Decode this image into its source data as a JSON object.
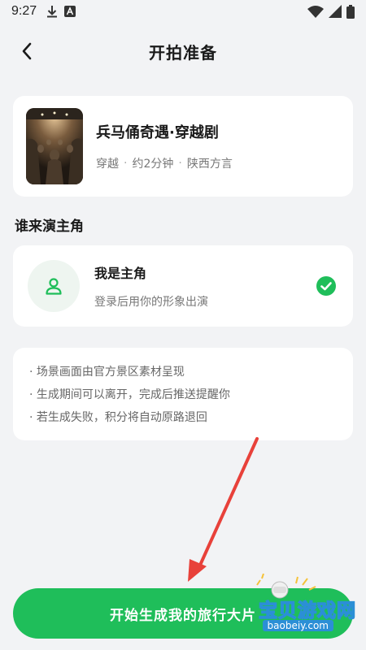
{
  "status_bar": {
    "time": "9:27",
    "icons": [
      "download-icon",
      "notification-a-icon",
      "wifi-icon",
      "signal-icon",
      "battery-icon"
    ]
  },
  "header": {
    "title": "开拍准备",
    "back_icon": "chevron-left-icon"
  },
  "project": {
    "title": "兵马俑奇遇·穿越剧",
    "meta": [
      "穿越",
      "约2分钟",
      "陕西方言"
    ],
    "meta_separator": "·"
  },
  "cast_section": {
    "title": "谁来演主角",
    "option": {
      "title": "我是主角",
      "description": "登录后用你的形象出演",
      "selected": true
    }
  },
  "tips": [
    "· 场景画面由官方景区素材呈现",
    "· 生成期间可以离开，完成后推送提醒你",
    "· 若生成失败，积分将自动原路退回"
  ],
  "start_button": {
    "label": "开始生成我的旅行大片"
  },
  "watermark": {
    "title": "宝贝游戏网",
    "url": "baobeiy.com"
  },
  "colors": {
    "accent": "#1fbe5a",
    "background": "#f2f3f5",
    "annotation_arrow": "#e8413a"
  }
}
